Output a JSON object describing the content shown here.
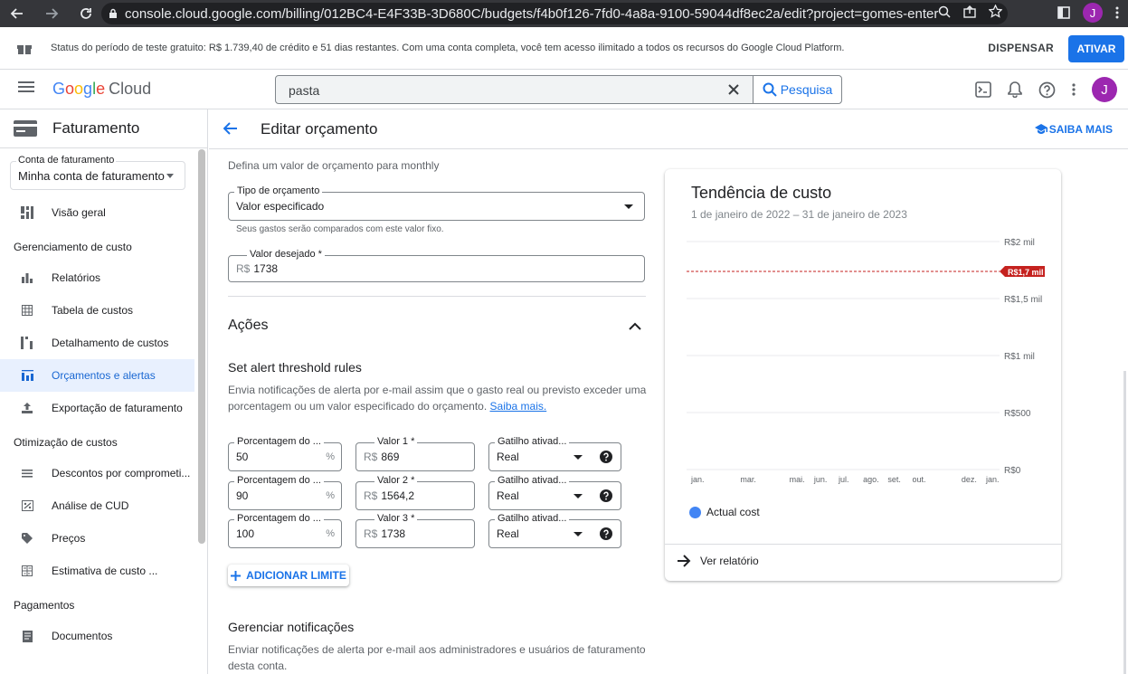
{
  "browser": {
    "url": "console.cloud.google.com/billing/012BC4-E4F33B-3D680C/budgets/f4b0f126-7fd0-4a8a-9100-59044df8ec2a/edit?project=gomes-enterprise-36...",
    "profile_initial": "J"
  },
  "banner": {
    "message": "Status do período de teste gratuito: R$ 1.739,40 de crédito e 51 dias restantes. Com uma conta completa, você tem acesso ilimitado a todos os recursos do Google Cloud Platform.",
    "dismiss_label": "DISPENSAR",
    "activate_label": "ATIVAR"
  },
  "topbar": {
    "logo_google": [
      "G",
      "o",
      "o",
      "g",
      "l",
      "e"
    ],
    "logo_cloud": "Cloud",
    "search_value": "pasta",
    "search_button": "Pesquisa",
    "avatar_initial": "J"
  },
  "sidebar": {
    "title": "Faturamento",
    "account_label": "Conta de faturamento",
    "account_value": "Minha conta de faturamento",
    "overview": "Visão geral",
    "section_cost_mgmt": "Gerenciamento de custo",
    "reports": "Relatórios",
    "cost_table": "Tabela de custos",
    "cost_breakdown": "Detalhamento de custos",
    "budgets_alerts": "Orçamentos e alertas",
    "billing_export": "Exportação de faturamento",
    "section_cost_opt": "Otimização de custos",
    "commitment_discounts": "Descontos por comprometi...",
    "cud_analysis": "Análise de CUD",
    "pricing": "Preços",
    "cost_estimate": "Estimativa de custo ...",
    "section_payments": "Pagamentos",
    "documents": "Documentos"
  },
  "page": {
    "title": "Editar orçamento",
    "learn_more": "SAIBA MAIS"
  },
  "form": {
    "budget_hint": "Defina um valor de orçamento para monthly",
    "budget_type_label": "Tipo de orçamento",
    "budget_type_value": "Valor especificado",
    "budget_type_help": "Seus gastos serão comparados com este valor fixo.",
    "target_label": "Valor desejado *",
    "currency": "R$",
    "target_value": "1738",
    "actions_title": "Ações",
    "threshold_title": "Set alert threshold rules",
    "threshold_desc_1": "Envia notificações de alerta por e-mail assim que o gasto real ou previsto exceder uma",
    "threshold_desc_2": "porcentagem ou um valor especificado do orçamento.",
    "threshold_link": "Saiba mais.",
    "percent_label": "Porcentagem do ...",
    "percent_suffix": "%",
    "trigger_label": "Gatilho ativad...",
    "rules": [
      {
        "percent": "50",
        "amount_label": "Valor 1 *",
        "amount": "869",
        "trigger": "Real"
      },
      {
        "percent": "90",
        "amount_label": "Valor 2 *",
        "amount": "1564,2",
        "trigger": "Real"
      },
      {
        "percent": "100",
        "amount_label": "Valor 3 *",
        "amount": "1738",
        "trigger": "Real"
      }
    ],
    "add_threshold": "ADICIONAR LIMITE",
    "notifications_title": "Gerenciar notificações",
    "notifications_desc_1": "Enviar notificações de alerta por e-mail aos administradores e usuários de faturamento",
    "notifications_desc_2": "desta conta."
  },
  "chart_card": {
    "view_report": "Ver relatório"
  },
  "chart_data": {
    "type": "line",
    "title": "Tendência de custo",
    "subtitle": "1 de janeiro de 2022 – 31 de janeiro de 2023",
    "x_tick_labels": [
      "jan.",
      "mar.",
      "mai.",
      "jun.",
      "jul.",
      "ago.",
      "set.",
      "out.",
      "dez.",
      "jan."
    ],
    "y_ticks": [
      0,
      500,
      1000,
      1500,
      2000
    ],
    "y_tick_labels": [
      "R$0",
      "R$500",
      "R$1 mil",
      "R$1,5 mil",
      "R$2 mil"
    ],
    "ylim": [
      0,
      2000
    ],
    "budget_line": {
      "value": 1738,
      "label": "R$1,7 mil",
      "color": "#c5221f"
    },
    "series": [
      {
        "name": "Actual cost",
        "color": "#4285f4",
        "values": []
      }
    ],
    "legend": "bottom-left",
    "grid": true
  }
}
